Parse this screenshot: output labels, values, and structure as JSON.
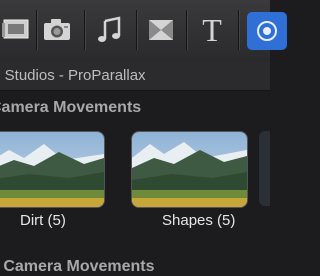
{
  "toolbar": {
    "buttons": [
      {
        "icon": "film-icon"
      },
      {
        "icon": "camera-icon"
      },
      {
        "icon": "music-icon"
      },
      {
        "icon": "transition-icon"
      },
      {
        "icon": "title-icon",
        "glyph": "T"
      },
      {
        "icon": "generator-icon"
      }
    ]
  },
  "library": {
    "header": "m Studios - ProParallax",
    "section_1": "Camera Movements",
    "section_2": "e Camera Movements"
  },
  "thumbnails": [
    {
      "label": "Dirt (5)"
    },
    {
      "label": "Shapes (5)"
    }
  ]
}
